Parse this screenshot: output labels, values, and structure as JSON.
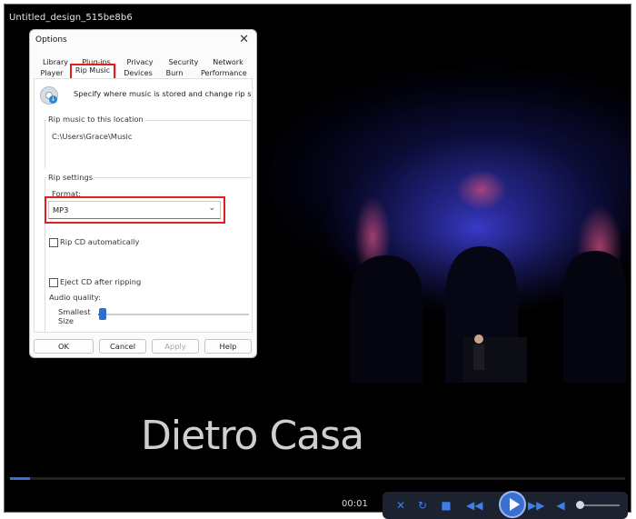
{
  "window": {
    "title": "Untitled_design_515be8b6"
  },
  "video": {
    "caption": "Dietro Casa"
  },
  "player": {
    "time": "00:01",
    "progress_fraction": 0.03,
    "volume_fraction": 0.1
  },
  "dialog": {
    "title": "Options",
    "tabs_row1": [
      "Library",
      "Plug-ins",
      "Privacy",
      "Security",
      "Network"
    ],
    "tabs_row2": [
      "Player",
      "Rip Music",
      "Devices",
      "Burn",
      "Performance"
    ],
    "active_tab": "Rip Music",
    "description": "Specify where music is stored and change rip setting",
    "location_group": "Rip music to this location",
    "location_path": "C:\\Users\\Grace\\Music",
    "rip_settings_group": "Rip settings",
    "format_label": "Format:",
    "format_value": "MP3",
    "rip_cd_auto": "Rip CD automatically",
    "eject_cd": "Eject CD after ripping",
    "audio_quality": "Audio quality:",
    "smallest": "Smallest",
    "size": "Size",
    "buttons": {
      "ok": "OK",
      "cancel": "Cancel",
      "apply": "Apply",
      "help": "Help"
    }
  }
}
